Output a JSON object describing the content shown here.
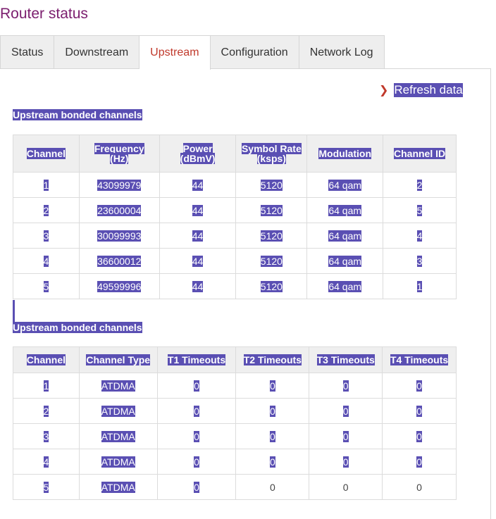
{
  "page": {
    "title": "Router status"
  },
  "tabs": [
    {
      "label": "Status"
    },
    {
      "label": "Downstream"
    },
    {
      "label": "Upstream"
    },
    {
      "label": "Configuration"
    },
    {
      "label": "Network Log"
    }
  ],
  "active_tab": "Upstream",
  "colors": {
    "accent": "#c0392b",
    "title": "#7b1e6e",
    "selection": "#5a4fb3"
  },
  "refresh": {
    "label": "Refresh data",
    "icon": "chevron-right-icon"
  },
  "table1": {
    "title": "Upstream bonded channels",
    "headers": [
      [
        "Channel"
      ],
      [
        "Frequency",
        "(Hz)"
      ],
      [
        "Power",
        "(dBmV)"
      ],
      [
        "Symbol Rate",
        "(ksps)"
      ],
      [
        "Modulation"
      ],
      [
        "Channel ID"
      ]
    ],
    "rows": [
      [
        "1",
        "43099979",
        "44",
        "5120",
        "64 qam",
        "2"
      ],
      [
        "2",
        "23600004",
        "44",
        "5120",
        "64 qam",
        "5"
      ],
      [
        "3",
        "30099993",
        "44",
        "5120",
        "64 qam",
        "4"
      ],
      [
        "4",
        "36600012",
        "44",
        "5120",
        "64 qam",
        "3"
      ],
      [
        "5",
        "49599996",
        "44",
        "5120",
        "64 qam",
        "1"
      ]
    ]
  },
  "table2": {
    "title": "Upstream bonded channels",
    "headers": [
      "Channel",
      "Channel Type",
      "T1 Timeouts",
      "T2 Timeouts",
      "T3 Timeouts",
      "T4 Timeouts"
    ],
    "rows": [
      [
        "1",
        "ATDMA",
        "0",
        "0",
        "0",
        "0"
      ],
      [
        "2",
        "ATDMA",
        "0",
        "0",
        "0",
        "0"
      ],
      [
        "3",
        "ATDMA",
        "0",
        "0",
        "0",
        "0"
      ],
      [
        "4",
        "ATDMA",
        "0",
        "0",
        "0",
        "0"
      ],
      [
        "5",
        "ATDMA",
        "0",
        "0",
        "0",
        "0"
      ]
    ]
  }
}
